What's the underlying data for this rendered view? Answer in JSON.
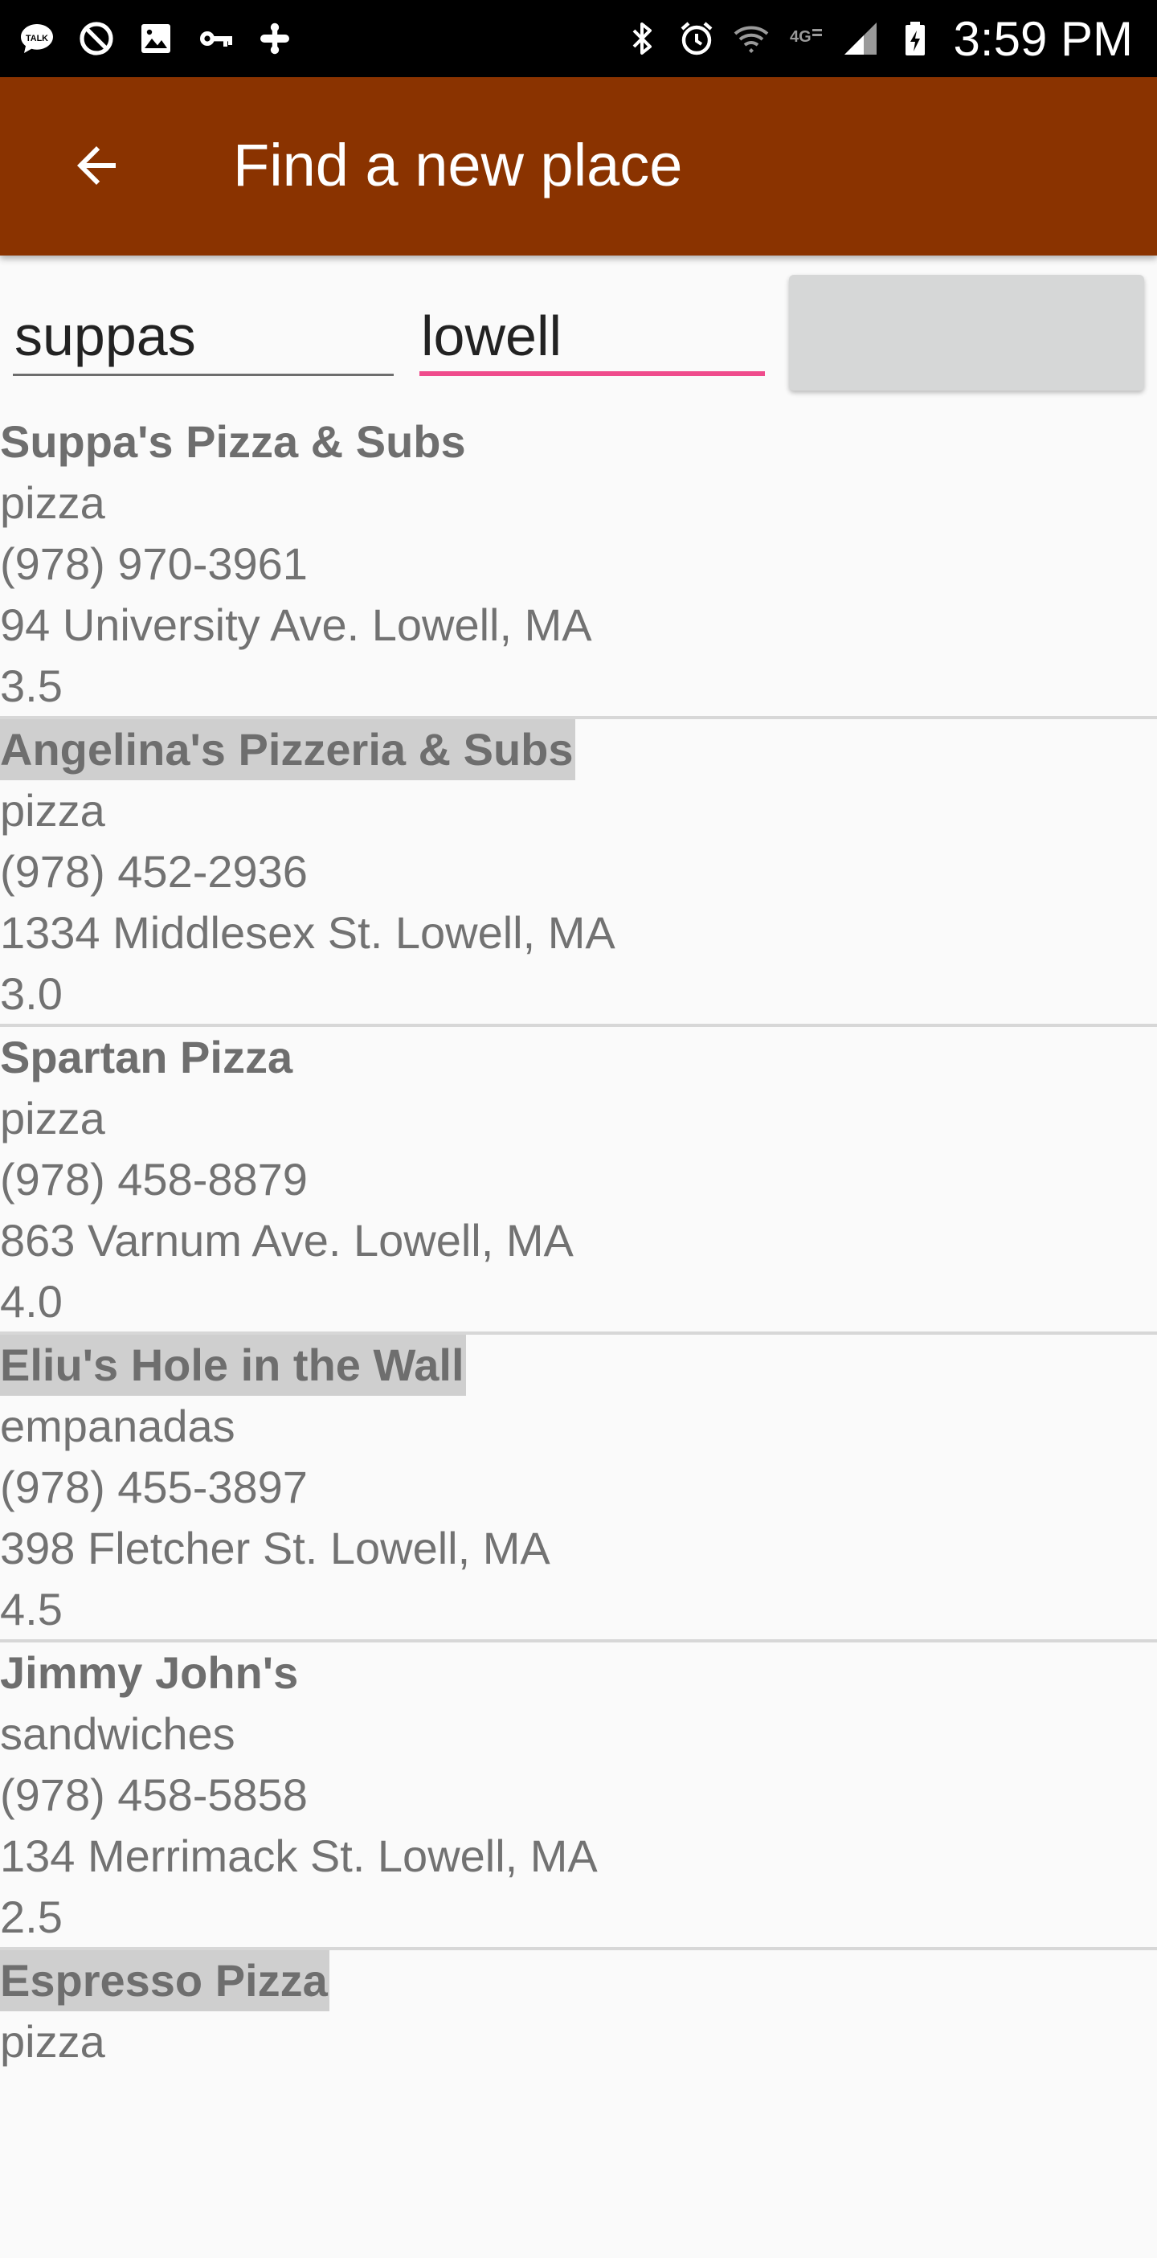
{
  "status_bar": {
    "time": "3:59 PM",
    "left_icons": [
      "talk-icon",
      "block-icon",
      "image-icon",
      "key-icon",
      "plus-cross-icon"
    ],
    "right_icons": [
      "bluetooth-icon",
      "alarm-icon",
      "wifi-icon",
      "4g-lte-icon",
      "signal-icon",
      "battery-charging-icon"
    ],
    "network_label": "4G"
  },
  "app_bar": {
    "title": "Find a new place",
    "back_icon": "arrow-back-icon",
    "color": "#8a3300"
  },
  "search": {
    "name_value": "suppas",
    "location_value": "lowell",
    "accent_color": "#ef4c8c"
  },
  "results": [
    {
      "name": "Suppa's Pizza & Subs",
      "category": "pizza",
      "phone": "(978) 970-3961",
      "address": "94 University Ave. Lowell, MA",
      "rating": "3.5"
    },
    {
      "name": "Angelina's Pizzeria & Subs",
      "category": "pizza",
      "phone": "(978) 452-2936",
      "address": "1334 Middlesex St. Lowell, MA",
      "rating": "3.0"
    },
    {
      "name": "Spartan Pizza",
      "category": "pizza",
      "phone": "(978) 458-8879",
      "address": "863 Varnum Ave. Lowell, MA",
      "rating": "4.0"
    },
    {
      "name": "Eliu's Hole in the Wall",
      "category": "empanadas",
      "phone": "(978) 455-3897",
      "address": "398 Fletcher St. Lowell, MA",
      "rating": "4.5"
    },
    {
      "name": "Jimmy John's",
      "category": "sandwiches",
      "phone": "(978) 458-5858",
      "address": "134 Merrimack St. Lowell, MA",
      "rating": "2.5"
    },
    {
      "name": "Espresso Pizza",
      "category": "pizza"
    }
  ]
}
